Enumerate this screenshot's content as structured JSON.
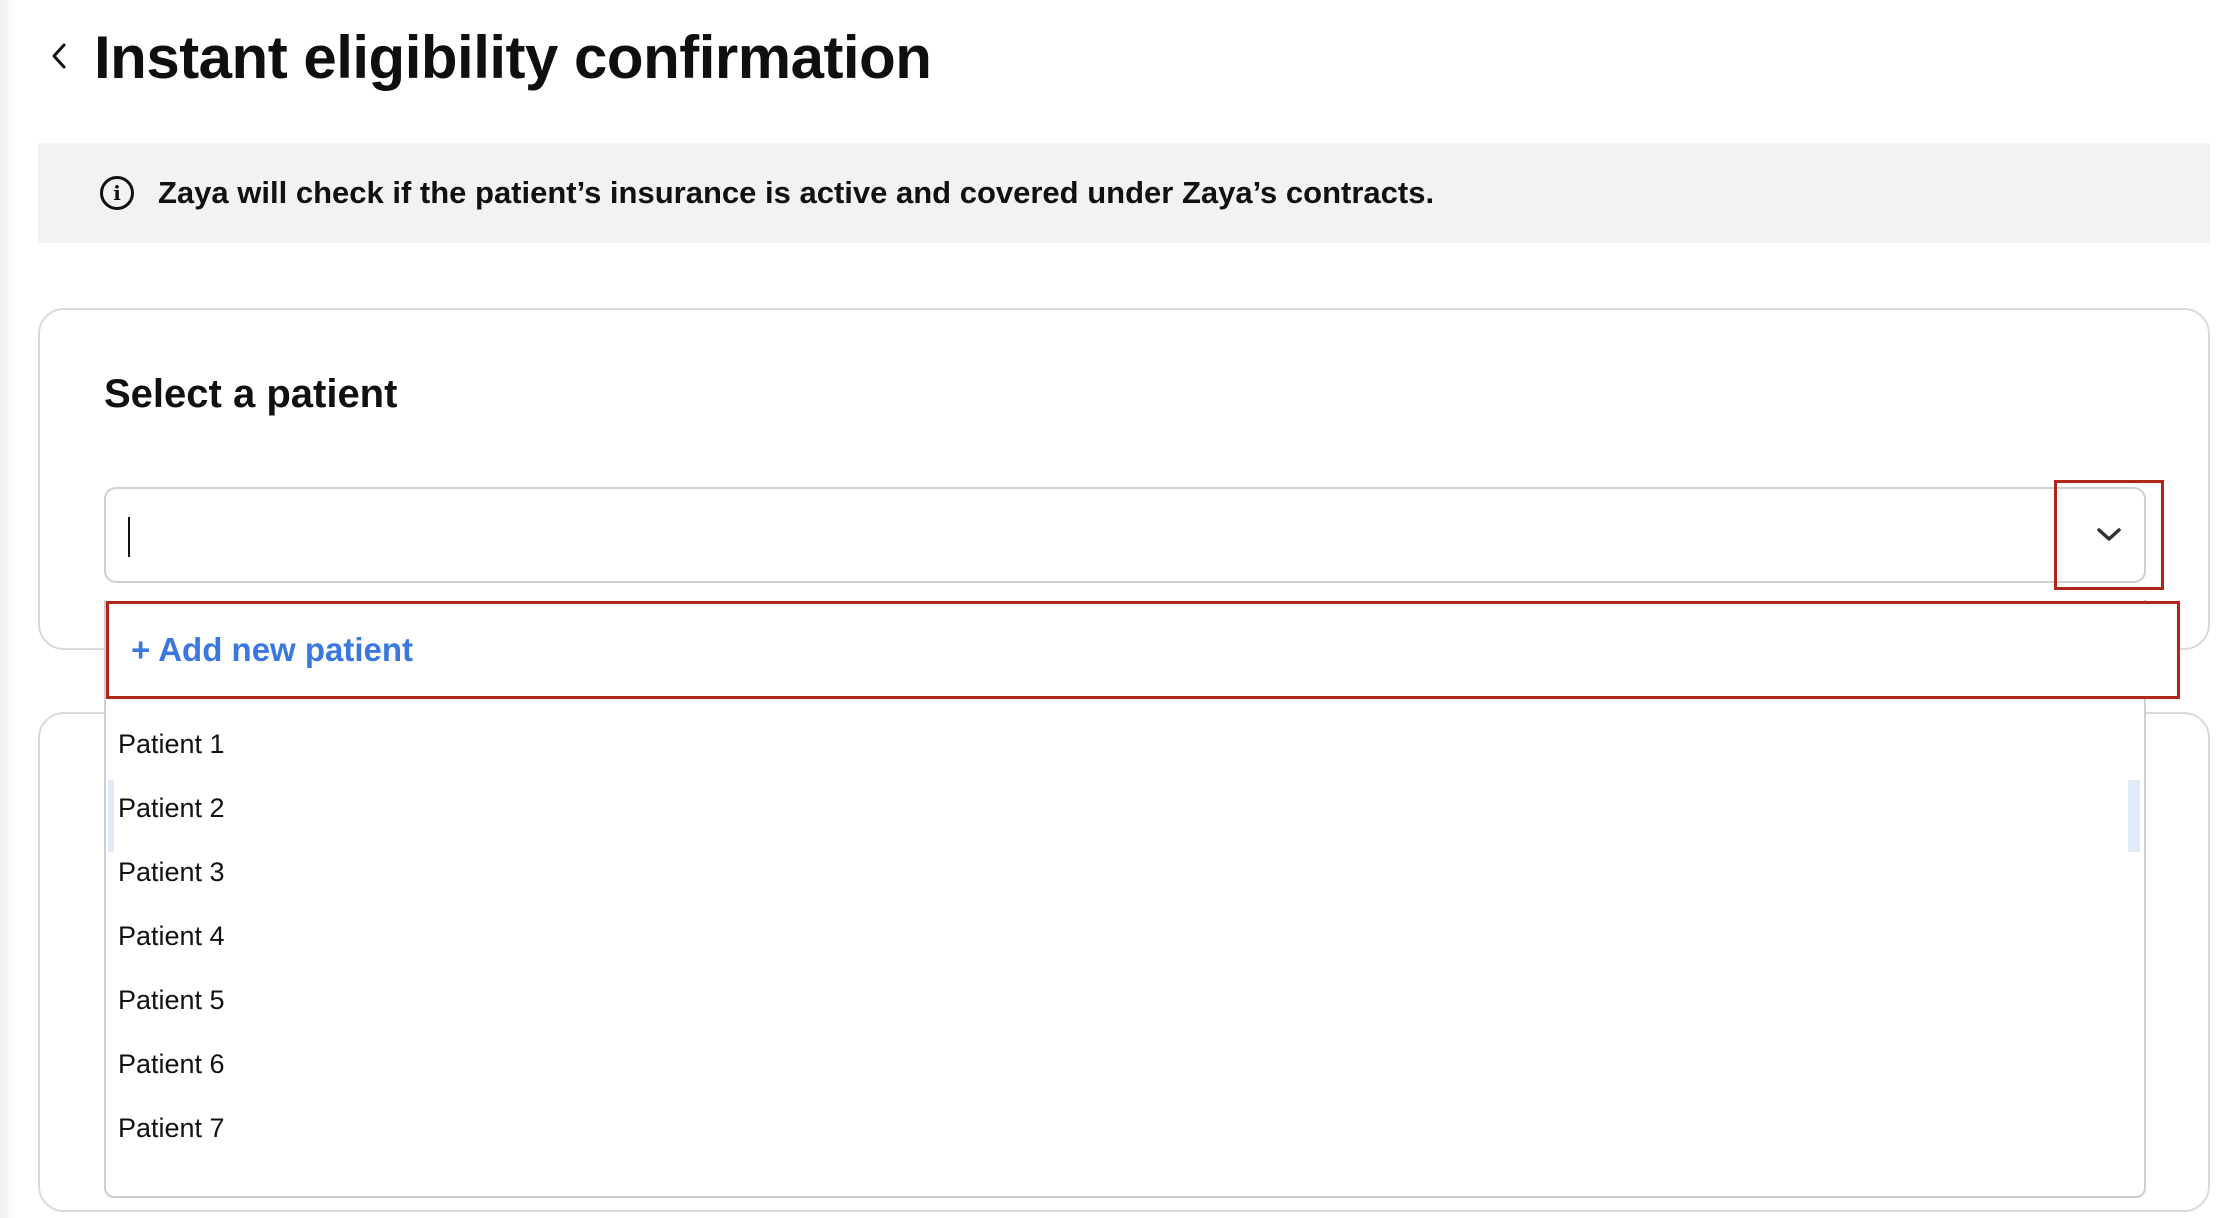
{
  "header": {
    "title": "Instant eligibility confirmation"
  },
  "info_banner": {
    "text": "Zaya will check if the patient’s insurance is active and covered under Zaya’s contracts.",
    "icon": "info-icon"
  },
  "patient_card": {
    "title": "Select a patient",
    "input_value": "",
    "dropdown_icon": "chevron-down-icon"
  },
  "dropdown": {
    "add_new_label": "+ Add new patient",
    "options": [
      "Patient 1",
      "Patient 2",
      "Patient 3",
      "Patient 4",
      "Patient 5",
      "Patient 6",
      "Patient 7"
    ],
    "highlighted_index": 1
  },
  "colors": {
    "link_blue": "#3a78e0",
    "highlight_red": "#b3241a",
    "banner_bg": "#f2f2f2",
    "hover_bg": "#e2eaf8"
  }
}
